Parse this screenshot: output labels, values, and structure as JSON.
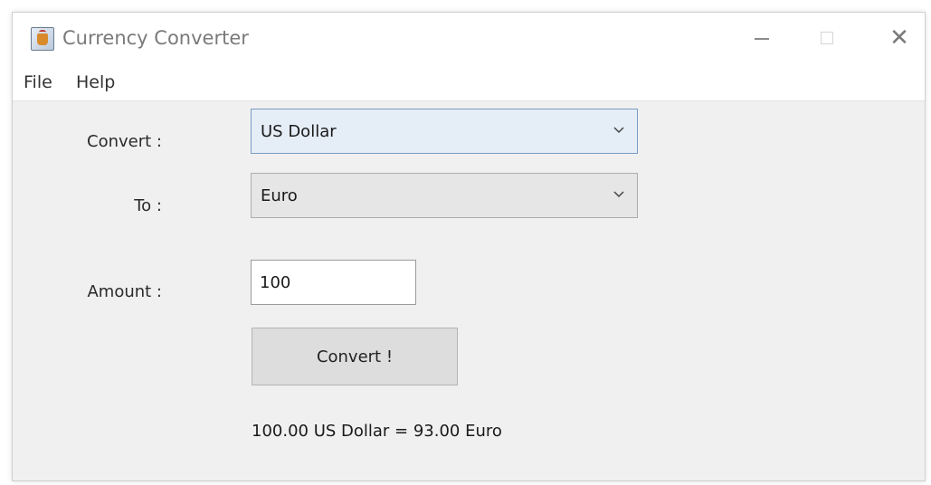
{
  "window": {
    "title": "Currency Converter",
    "icon": "java-app-icon",
    "controls": [
      "minimize-icon",
      "maximize-icon",
      "close-icon"
    ],
    "close_glyph": "✕"
  },
  "menubar": {
    "items": [
      {
        "label": "File"
      },
      {
        "label": "Help"
      }
    ]
  },
  "form": {
    "convert_label": "Convert :",
    "to_label": "To :",
    "amount_label": "Amount :",
    "from_currency": "US Dollar",
    "to_currency": "Euro",
    "amount_value": "100",
    "convert_button_label": "Convert !",
    "result_text": "100.00 US Dollar = 93.00 Euro"
  },
  "colors": {
    "window_bg": "#f0f0f0",
    "active_combo_bg": "#e5edf6",
    "active_combo_border": "#7a9cc6",
    "button_bg": "#dddddd"
  }
}
